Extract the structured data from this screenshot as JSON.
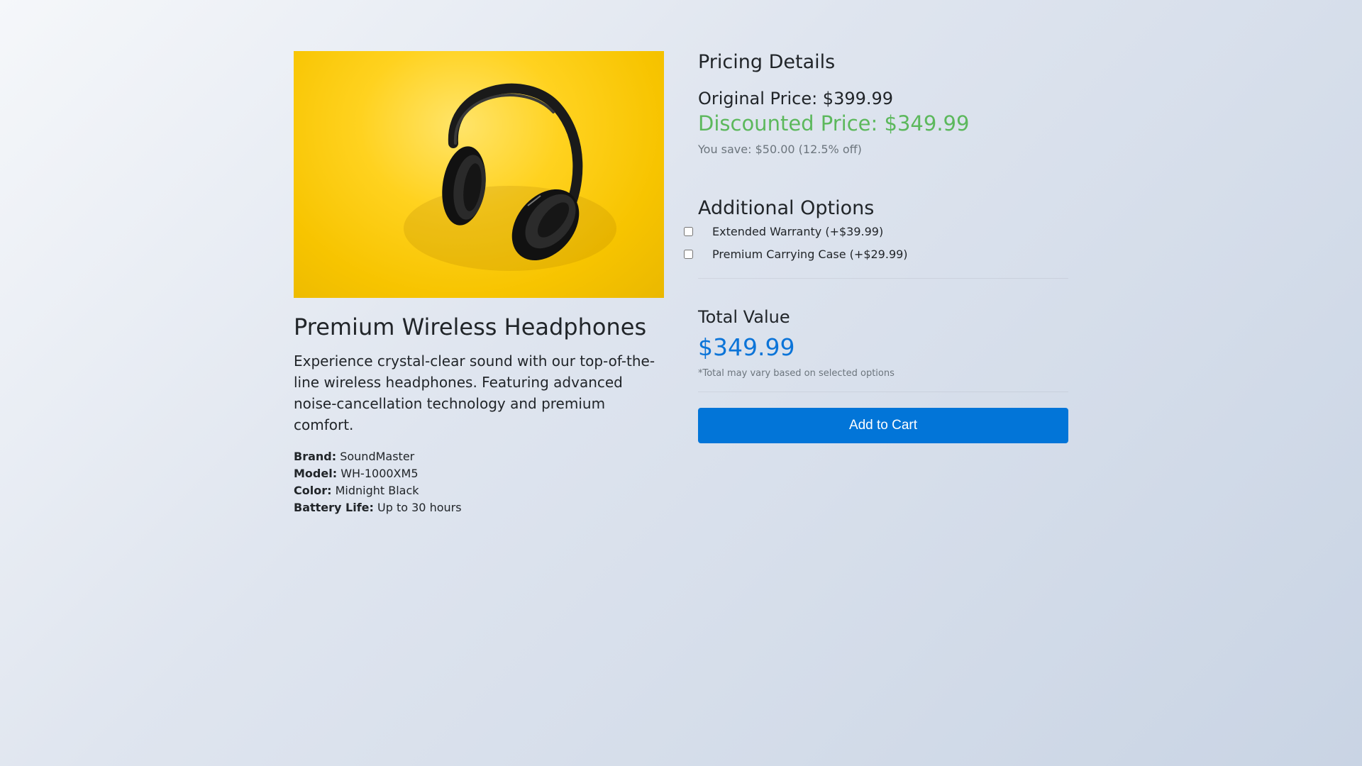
{
  "product": {
    "title": "Premium Wireless Headphones",
    "description": "Experience crystal-clear sound with our top-of-the-line wireless headphones. Featuring advanced noise-cancellation technology and premium comfort.",
    "specs": [
      {
        "label": "Brand:",
        "value": "SoundMaster"
      },
      {
        "label": "Model:",
        "value": "WH-1000XM5"
      },
      {
        "label": "Color:",
        "value": "Midnight Black"
      },
      {
        "label": "Battery Life:",
        "value": "Up to 30 hours"
      }
    ]
  },
  "pricing": {
    "title": "Pricing Details",
    "original": "Original Price: $399.99",
    "discounted": "Discounted Price: $349.99",
    "savings": "You save: $50.00 (12.5% off)"
  },
  "options": {
    "title": "Additional Options",
    "items": [
      {
        "label": "Extended Warranty (+$39.99)",
        "checked": false
      },
      {
        "label": "Premium Carrying Case (+$29.99)",
        "checked": false
      }
    ]
  },
  "total": {
    "title": "Total Value",
    "value": "$349.99",
    "note": "*Total may vary based on selected options"
  },
  "cart": {
    "label": "Add to Cart"
  },
  "colors": {
    "discount_green": "#5cb85c",
    "total_blue": "#0b74d8",
    "button_blue": "#0275d8",
    "image_yellow": "#ffd21f"
  }
}
